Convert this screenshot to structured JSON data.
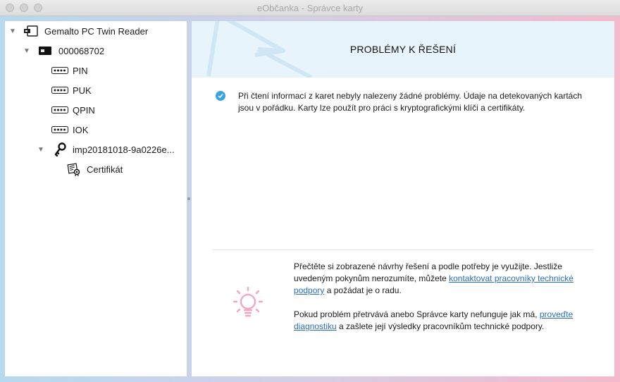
{
  "window": {
    "title": "eObčanka - Správce karty"
  },
  "tree": {
    "reader": "Gemalto PC Twin Reader",
    "card": "000068702",
    "items": [
      "PIN",
      "PUK",
      "QPIN",
      "IOK"
    ],
    "key": "imp20181018-9a0226e...",
    "certificate": "Certifikát"
  },
  "main": {
    "heading": "PROBLÉMY K ŘEŠENÍ",
    "status_text": "Při čtení informací z karet nebyly nalezeny žádné problémy. Údaje na detekovaných kartách jsou v pořádku. Karty lze použít pro práci s kryptografickými klíči a certifikáty.",
    "help": {
      "p1_before": "Přečtěte si zobrazené návrhy řešení a podle potřeby je využijte. Jestliže uvedeným pokynům nerozumíte, můžete ",
      "p1_link": "kontaktovat pracovníky technické podpory",
      "p1_after": " a požádat je o radu.",
      "p2_before": "Pokud problém přetrvává anebo Správce karty nefunguje jak má, ",
      "p2_link": "proveďte diagnostiku",
      "p2_after": " a zašlete její výsledky pracovníkům technické podpory."
    }
  },
  "colors": {
    "accent_blue": "#3aa3e0",
    "link": "#2a6ebf",
    "bulb_pink": "#f3a7bf",
    "hero_bg": "#e8f4fb"
  },
  "icons": {
    "reader": "card-reader-icon",
    "card": "smart-card-icon",
    "pin": "pin-dots-icon",
    "key": "key-icon",
    "certificate": "certificate-icon",
    "check": "check-icon",
    "bulb": "lightbulb-icon"
  }
}
